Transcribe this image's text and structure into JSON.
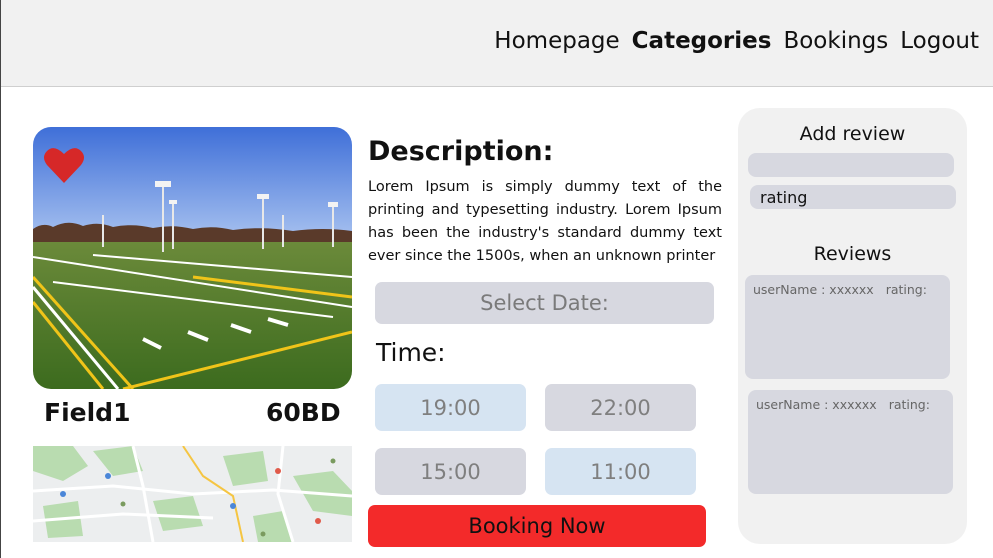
{
  "nav": {
    "items": [
      {
        "label": "Homepage",
        "active": false
      },
      {
        "label": "Categories",
        "active": true
      },
      {
        "label": "Bookings",
        "active": false
      },
      {
        "label": "Logout",
        "active": false
      }
    ]
  },
  "field": {
    "name": "Field1",
    "price": "60BD",
    "favorite_icon": "heart-icon",
    "favorite_color": "#d62828"
  },
  "description": {
    "title": "Description:",
    "text": "Lorem Ipsum is simply dummy text of the printing and typesetting industry. Lorem Ipsum has been the industry's standard dummy text ever since the 1500s, when an unknown printer"
  },
  "booking": {
    "select_date_label": "Select Date:",
    "time_label": "Time:",
    "slots": [
      {
        "time": "19:00",
        "status": "available"
      },
      {
        "time": "22:00",
        "status": "taken"
      },
      {
        "time": "15:00",
        "status": "taken"
      },
      {
        "time": "11:00",
        "status": "available"
      }
    ],
    "button_label": "Booking Now",
    "button_color": "#f32a2a"
  },
  "reviews": {
    "add_title": "Add review",
    "text_placeholder": "",
    "rating_placeholder": "rating",
    "list_title": "Reviews",
    "items": [
      {
        "user": "userName : xxxxxx",
        "rating": "rating:"
      },
      {
        "user": "userName : xxxxxx",
        "rating": "rating:"
      }
    ]
  }
}
